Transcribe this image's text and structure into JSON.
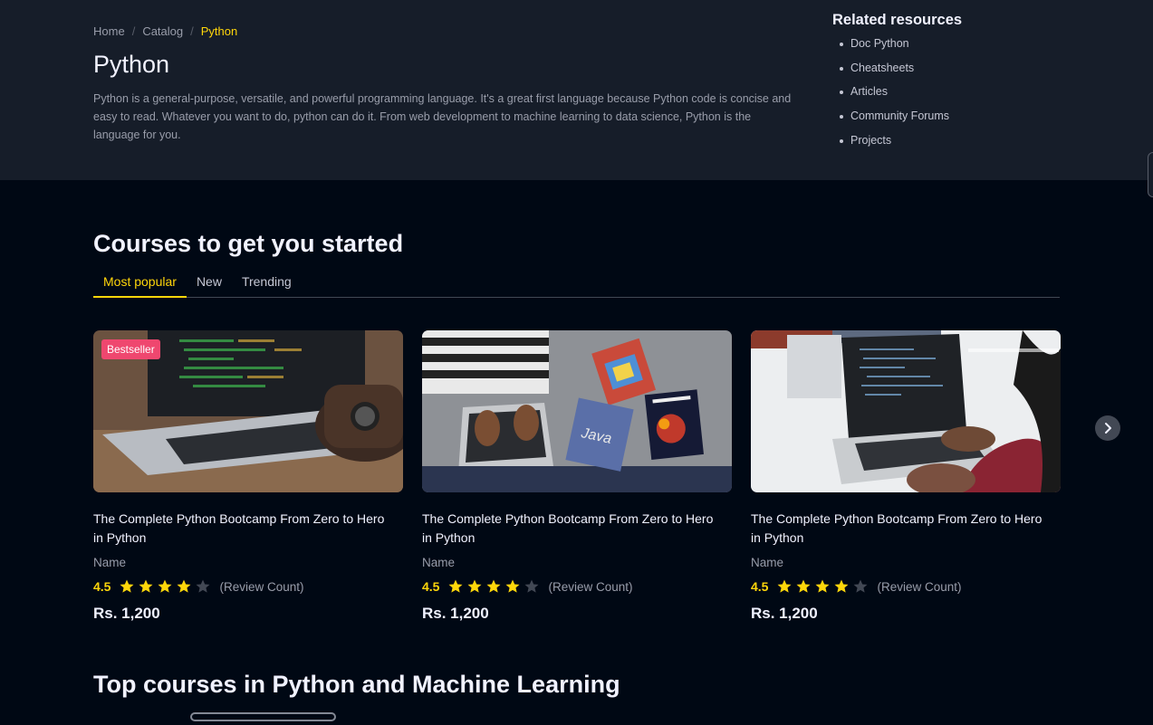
{
  "breadcrumb": {
    "home": "Home",
    "sep1": "/",
    "catalog": "Catalog",
    "sep2": "/",
    "current": "Python"
  },
  "page": {
    "title": "Python",
    "description": "Python is a general-purpose, versatile, and powerful programming language. It's a great first language because Python code is concise and easy to read. Whatever you want to do, python can do it. From web development to machine learning to data science, Python is the language for you."
  },
  "related": {
    "title": "Related resources",
    "items": [
      "Doc Python",
      "Cheatsheets",
      "Articles",
      "Community Forums",
      "Projects"
    ]
  },
  "courses_section": {
    "title": "Courses to get you started",
    "tabs": [
      "Most popular",
      "New",
      "Trending"
    ],
    "active_tab": "Most popular"
  },
  "cards": [
    {
      "badge": "Bestseller",
      "title": "The Complete Python Bootcamp From Zero to Hero in Python",
      "author": "Name",
      "rating": "4.5",
      "stars_filled": 4,
      "stars_total": 5,
      "reviews": "(Review Count)",
      "price": "Rs. 1,200",
      "image_icon": "laptop-photo"
    },
    {
      "badge": "",
      "title": "The Complete Python Bootcamp From Zero to Hero in Python",
      "author": "Name",
      "rating": "4.5",
      "stars_filled": 4,
      "stars_total": 5,
      "reviews": "(Review Count)",
      "price": "Rs. 1,200",
      "image_icon": "books-laptop-photo"
    },
    {
      "badge": "",
      "title": "The Complete Python Bootcamp From Zero to Hero in Python",
      "author": "Name",
      "rating": "4.5",
      "stars_filled": 4,
      "stars_total": 5,
      "reviews": "(Review Count)",
      "price": "Rs. 1,200",
      "image_icon": "coding-laptop-photo"
    }
  ],
  "top_section": {
    "title": "Top courses in Python and Machine Learning"
  },
  "colors": {
    "accent": "#ffd60a",
    "badge": "#ef476f",
    "star_empty": "#424854",
    "bg": "#000814",
    "hero_bg": "#161d29"
  }
}
